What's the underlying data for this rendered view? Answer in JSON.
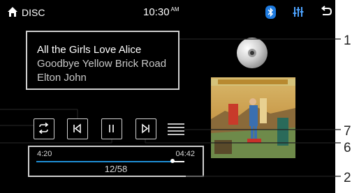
{
  "topbar": {
    "source": "DISC",
    "time": "10:30",
    "ampm": "AM"
  },
  "track": {
    "title": "All the Girls Love Alice",
    "album": "Goodbye Yellow Brick Road",
    "artist": "Elton John"
  },
  "progress": {
    "elapsed": "4:20",
    "total": "04:42",
    "fraction": 0.92,
    "track_count": "12/58"
  },
  "callouts": {
    "c1": "1",
    "c2": "2",
    "c6": "6",
    "c7": "7"
  },
  "colors": {
    "accent": "#1f8fd6",
    "background": "#000000",
    "bluetooth": "#1e7be0"
  }
}
